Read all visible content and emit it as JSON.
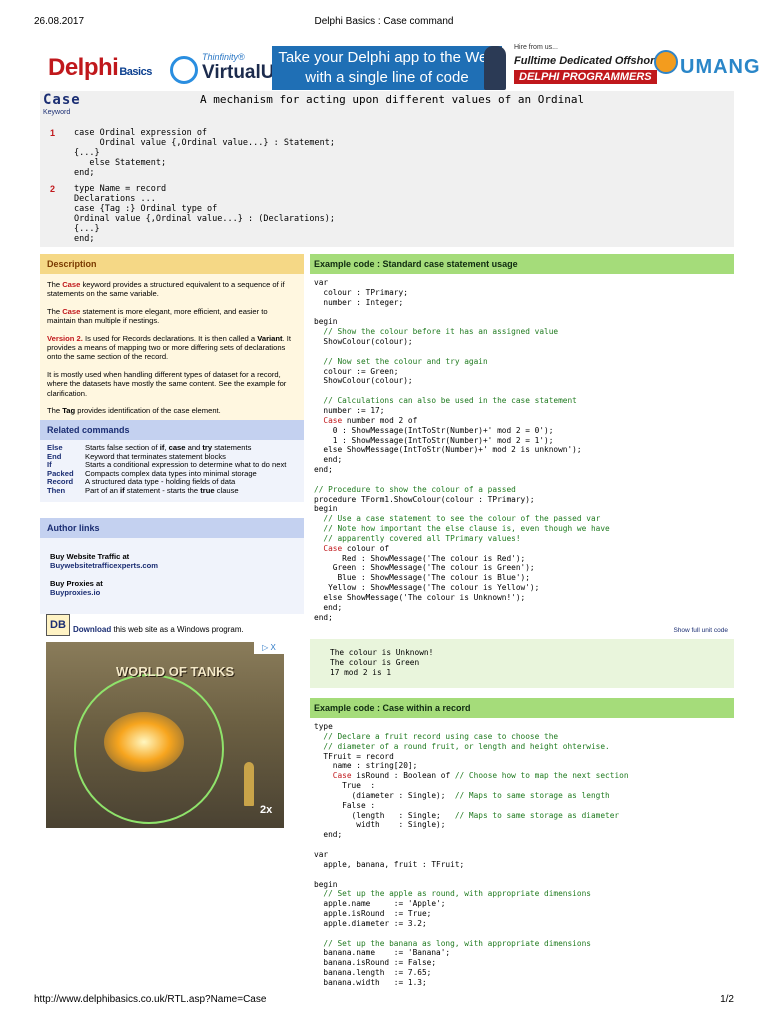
{
  "print_header": {
    "date": "26.08.2017",
    "title": "Delphi Basics : Case command"
  },
  "print_footer": {
    "url": "http://www.delphibasics.co.uk/RTL.asp?Name=Case",
    "page": "1/2"
  },
  "banner": {
    "logo_main": "Delphi",
    "logo_sub": "Basics",
    "ad_thinfinity": "Thinfinity®",
    "ad_virtualui": "VirtualUI",
    "ad_main_line1": "Take your Delphi app to the Web",
    "ad_main_line2": "with a single line of code",
    "ad_hire": "Hire from us...",
    "ad_fulltime": "Fulltime Dedicated Offshore",
    "ad_delphi_programmers": "DELPHI PROGRAMMERS",
    "ad_umang": "UMANG"
  },
  "keyword": {
    "name": "Case",
    "type": "Keyword",
    "description": "A mechanism for acting upon different values of an Ordinal"
  },
  "syntax": {
    "versions": [
      {
        "num": "1",
        "lines": [
          "case Ordinal expression of",
          "     Ordinal value {,Ordinal value...} : Statement;",
          "{...}",
          "   else Statement;",
          "end;"
        ]
      },
      {
        "num": "2",
        "lines": [
          "type Name = record",
          "Declarations ...",
          "case {Tag :} Ordinal type of",
          "Ordinal value {,Ordinal value...} : (Declarations);",
          "{...}",
          "end;"
        ]
      }
    ]
  },
  "description": {
    "heading": "Description",
    "p1_pre": "The ",
    "p1_kw": "Case",
    "p1_post": " keyword provides a structured equivalent to a sequence of if statements on the same variable.",
    "p2_pre": "The ",
    "p2_kw": "Case",
    "p2_post": " statement is more elegant, more efficient, and easier to maintain than multiple if nestings.",
    "p3_kw": "Version 2.",
    "p3_a": " Is used for Records declarations. It is then called a ",
    "p3_b": "Variant",
    "p3_c": ". It provides a means of mapping two or more differing sets of declarations onto the same section of the record.",
    "p4": "It is mostly used when handling different types of dataset for a record, where the datasets have mostly the same content. See the example for clarification.",
    "p5_pre": "The ",
    "p5_kw": "Tag",
    "p5_post": " provides identification of the case element."
  },
  "related": {
    "heading": "Related commands",
    "items": [
      {
        "k": "Else",
        "d1": "Starts false section of ",
        "b1": "if",
        "d2": ", ",
        "b2": "case",
        "d3": " and ",
        "b3": "try",
        "d4": " statements"
      },
      {
        "k": "End",
        "d1": "Keyword that terminates statement blocks",
        "b1": "",
        "d2": "",
        "b2": "",
        "d3": "",
        "b3": "",
        "d4": ""
      },
      {
        "k": "If",
        "d1": "Starts a conditional expression to determine what to do next",
        "b1": "",
        "d2": "",
        "b2": "",
        "d3": "",
        "b3": "",
        "d4": ""
      },
      {
        "k": "Packed",
        "d1": "Compacts complex data types into minimal storage",
        "b1": "",
        "d2": "",
        "b2": "",
        "d3": "",
        "b3": "",
        "d4": ""
      },
      {
        "k": "Record",
        "d1": "A structured data type - holding fields of data",
        "b1": "",
        "d2": "",
        "b2": "",
        "d3": "",
        "b3": "",
        "d4": ""
      },
      {
        "k": "Then",
        "d1": "Part of an ",
        "b1": "if",
        "d2": " statement - starts the ",
        "b2": "true",
        "d3": " clause",
        "b3": "",
        "d4": ""
      }
    ]
  },
  "author": {
    "heading": "Author links",
    "buy_traffic": "Buy Website Traffic at",
    "traffic_link": "Buywebsitetrafficexperts.com",
    "buy_proxies": "Buy Proxies at",
    "proxies_link": "Buyproxies.io"
  },
  "download": {
    "icon": "DB",
    "link": "Download",
    "text": " this web site as a Windows program."
  },
  "ad_game": {
    "title": "WORLD OF TANKS",
    "badge": "2x",
    "ad_marker": "▷ X"
  },
  "example1": {
    "heading": "Example code : Standard case statement usage",
    "show_full": "Show full unit code",
    "code": [
      [
        [
          "",
          "var"
        ]
      ],
      [
        [
          "",
          "  colour : TPrimary;"
        ]
      ],
      [
        [
          "",
          "  number : Integer;"
        ]
      ],
      [
        [
          "",
          ""
        ]
      ],
      [
        [
          "",
          "begin"
        ]
      ],
      [
        [
          "c",
          "  // Show the colour before it has an assigned value"
        ]
      ],
      [
        [
          "",
          "  ShowColour(colour);"
        ]
      ],
      [
        [
          "",
          ""
        ]
      ],
      [
        [
          "c",
          "  // Now set the colour and try again"
        ]
      ],
      [
        [
          "",
          "  colour := Green;"
        ]
      ],
      [
        [
          "",
          "  ShowColour(colour);"
        ]
      ],
      [
        [
          "",
          ""
        ]
      ],
      [
        [
          "c",
          "  // Calculations can also be used in the case statement"
        ]
      ],
      [
        [
          "",
          "  number := 17;"
        ]
      ],
      [
        [
          "k",
          "  Case"
        ],
        [
          "",
          " number mod 2 of"
        ]
      ],
      [
        [
          "",
          "    0 : ShowMessage(IntToStr(Number)+' mod 2 = 0');"
        ]
      ],
      [
        [
          "",
          "    1 : ShowMessage(IntToStr(Number)+' mod 2 = 1');"
        ]
      ],
      [
        [
          "",
          "  else ShowMessage(IntToStr(Number)+' mod 2 is unknown');"
        ]
      ],
      [
        [
          "",
          "  end;"
        ]
      ],
      [
        [
          "",
          "end;"
        ]
      ],
      [
        [
          "",
          ""
        ]
      ],
      [
        [
          "c",
          "// Procedure to show the colour of a passed"
        ]
      ],
      [
        [
          "",
          "procedure TForm1.ShowColour(colour : TPrimary);"
        ]
      ],
      [
        [
          "",
          "begin"
        ]
      ],
      [
        [
          "c",
          "  // Use a case statement to see the colour of the passed var"
        ]
      ],
      [
        [
          "c",
          "  // Note how important the else clause is, even though we have"
        ]
      ],
      [
        [
          "c",
          "  // apparently covered all TPrimary values!"
        ]
      ],
      [
        [
          "k",
          "  Case"
        ],
        [
          "",
          " colour of"
        ]
      ],
      [
        [
          "",
          "      Red : ShowMessage('The colour is Red');"
        ]
      ],
      [
        [
          "",
          "    Green : ShowMessage('The colour is Green');"
        ]
      ],
      [
        [
          "",
          "     Blue : ShowMessage('The colour is Blue');"
        ]
      ],
      [
        [
          "",
          "   Yellow : ShowMessage('The colour is Yellow');"
        ]
      ],
      [
        [
          "",
          "  else ShowMessage('The colour is Unknown!');"
        ]
      ],
      [
        [
          "",
          "  end;"
        ]
      ],
      [
        [
          "",
          "end;"
        ]
      ]
    ],
    "output": [
      "The colour is Unknown!",
      "The colour is Green",
      "17 mod 2 is 1"
    ]
  },
  "example2": {
    "heading": "Example code : Case within a record",
    "code": [
      [
        [
          "",
          "type"
        ]
      ],
      [
        [
          "c",
          "  // Declare a fruit record using case to choose the"
        ]
      ],
      [
        [
          "c",
          "  // diameter of a round fruit, or length and height ohterwise."
        ]
      ],
      [
        [
          "",
          "  TFruit = record"
        ]
      ],
      [
        [
          "",
          "    name : string[20];"
        ]
      ],
      [
        [
          "k",
          "    Case"
        ],
        [
          "",
          " isRound : Boolean of "
        ],
        [
          "c",
          "// Choose how to map the next section"
        ]
      ],
      [
        [
          "",
          "      True  :"
        ]
      ],
      [
        [
          "",
          "        (diameter : Single);  "
        ],
        [
          "c",
          "// Maps to same storage as length"
        ]
      ],
      [
        [
          "",
          "      False :"
        ]
      ],
      [
        [
          "",
          "        (length   : Single;   "
        ],
        [
          "c",
          "// Maps to same storage as diameter"
        ]
      ],
      [
        [
          "",
          "         width    : Single);"
        ]
      ],
      [
        [
          "",
          "  end;"
        ]
      ],
      [
        [
          "",
          ""
        ]
      ],
      [
        [
          "",
          "var"
        ]
      ],
      [
        [
          "",
          "  apple, banana, fruit : TFruit;"
        ]
      ],
      [
        [
          "",
          ""
        ]
      ],
      [
        [
          "",
          "begin"
        ]
      ],
      [
        [
          "c",
          "  // Set up the apple as round, with appropriate dimensions"
        ]
      ],
      [
        [
          "",
          "  apple.name     := 'Apple';"
        ]
      ],
      [
        [
          "",
          "  apple.isRound  := True;"
        ]
      ],
      [
        [
          "",
          "  apple.diameter := 3.2;"
        ]
      ],
      [
        [
          "",
          ""
        ]
      ],
      [
        [
          "c",
          "  // Set up the banana as long, with appropriate dimensions"
        ]
      ],
      [
        [
          "",
          "  banana.name    := 'Banana';"
        ]
      ],
      [
        [
          "",
          "  banana.isRound := False;"
        ]
      ],
      [
        [
          "",
          "  banana.length  := 7.65;"
        ]
      ],
      [
        [
          "",
          "  banana.width   := 1.3;"
        ]
      ]
    ]
  }
}
